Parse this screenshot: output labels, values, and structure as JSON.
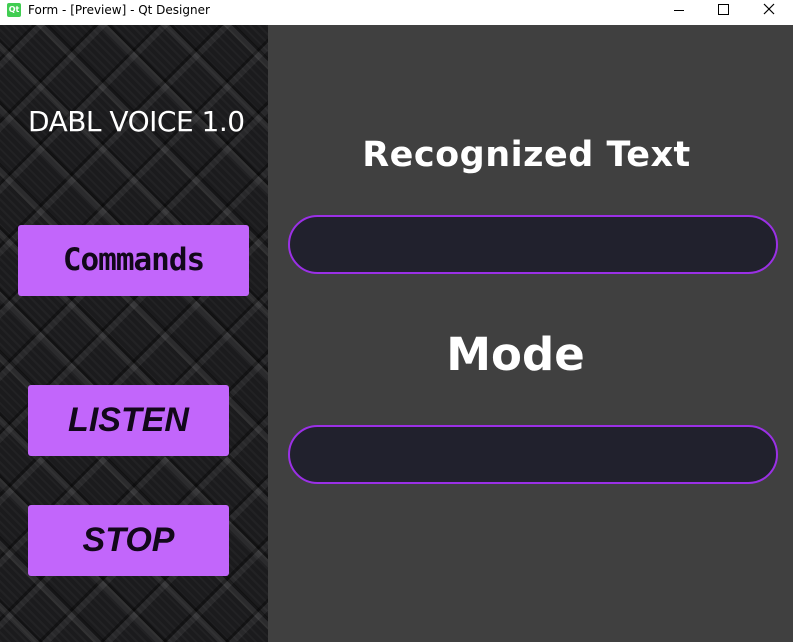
{
  "window": {
    "title": "Form - [Preview] - Qt Designer",
    "icon_text": "Qt",
    "controls": [
      "minimize-icon",
      "maximize-icon",
      "close-icon"
    ]
  },
  "sidebar": {
    "app_title": "DABL VOICE 1.0",
    "buttons": {
      "commands": "Commands",
      "listen": "LISTEN",
      "stop": "STOP"
    }
  },
  "main": {
    "recognized_label": "Recognized Text",
    "recognized_value": "",
    "mode_label": "Mode",
    "mode_value": ""
  },
  "colors": {
    "accent": "#c266fb",
    "field_border": "#9b30e6",
    "field_bg": "#21212d",
    "main_bg": "#404040",
    "sidebar_bg": "#1b1b1d"
  }
}
